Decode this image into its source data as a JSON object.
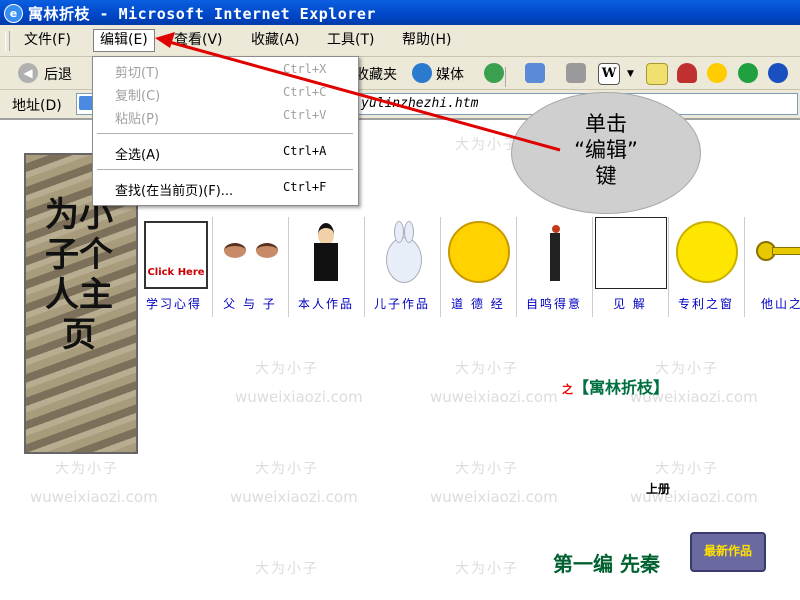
{
  "window": {
    "title": "寓林折枝 - Microsoft Internet Explorer",
    "logo": "ie-logo-icon"
  },
  "menubar": {
    "items": [
      {
        "label": "文件(F)"
      },
      {
        "label": "编辑(E)"
      },
      {
        "label": "查看(V)"
      },
      {
        "label": "收藏(A)"
      },
      {
        "label": "工具(T)"
      },
      {
        "label": "帮助(H)"
      }
    ],
    "active_index": 1
  },
  "toolbar": {
    "back_label": "后退",
    "favorites_label": "收藏夹",
    "media_label": "媒体"
  },
  "address": {
    "label": "地址(D)",
    "value": "yulinzhezhi.htm"
  },
  "edit_menu": {
    "groups": [
      [
        {
          "label": "剪切(T)",
          "shortcut": "Ctrl+X",
          "enabled": false
        },
        {
          "label": "复制(C)",
          "shortcut": "Ctrl+C",
          "enabled": false
        },
        {
          "label": "粘贴(P)",
          "shortcut": "Ctrl+V",
          "enabled": false
        }
      ],
      [
        {
          "label": "全选(A)",
          "shortcut": "Ctrl+A",
          "enabled": true
        }
      ],
      [
        {
          "label": "查找(在当前页)(F)...",
          "shortcut": "Ctrl+F",
          "enabled": true
        }
      ]
    ]
  },
  "callout": {
    "line1": "单击",
    "line2": "“编辑”",
    "line3": "键"
  },
  "page": {
    "banner_text": "为小子个人主页",
    "nav": [
      {
        "label": "学习心得",
        "icon": "book-clickhere-icon"
      },
      {
        "label": "父 与 子",
        "icon": "eyes-icon"
      },
      {
        "label": "本人作品",
        "icon": "man-in-suit-icon"
      },
      {
        "label": "儿子作品",
        "icon": "rabbit-icon"
      },
      {
        "label": "道 德 经",
        "icon": "smiley-face-icon"
      },
      {
        "label": "自鸣得意",
        "icon": "dancer-icon"
      },
      {
        "label": "见    解",
        "icon": "blank-page-icon"
      },
      {
        "label": "专利之窗",
        "icon": "sad-face-icon"
      },
      {
        "label": "他山之",
        "icon": "key-icon"
      }
    ],
    "subtitle_prefix": "之",
    "subtitle": "【寓林折枝】",
    "volume_label": "上册",
    "chapter": "第一编  先秦",
    "new_works_button": "最新作品",
    "watermark_cn": "大为小子",
    "watermark_url": "wuweixiaozi.com"
  },
  "colors": {
    "titlebar": "#0054e3",
    "menubar": "#ece9d8",
    "link": "#0000c0",
    "subtitle": "#007040",
    "arrow": "#e00000"
  }
}
